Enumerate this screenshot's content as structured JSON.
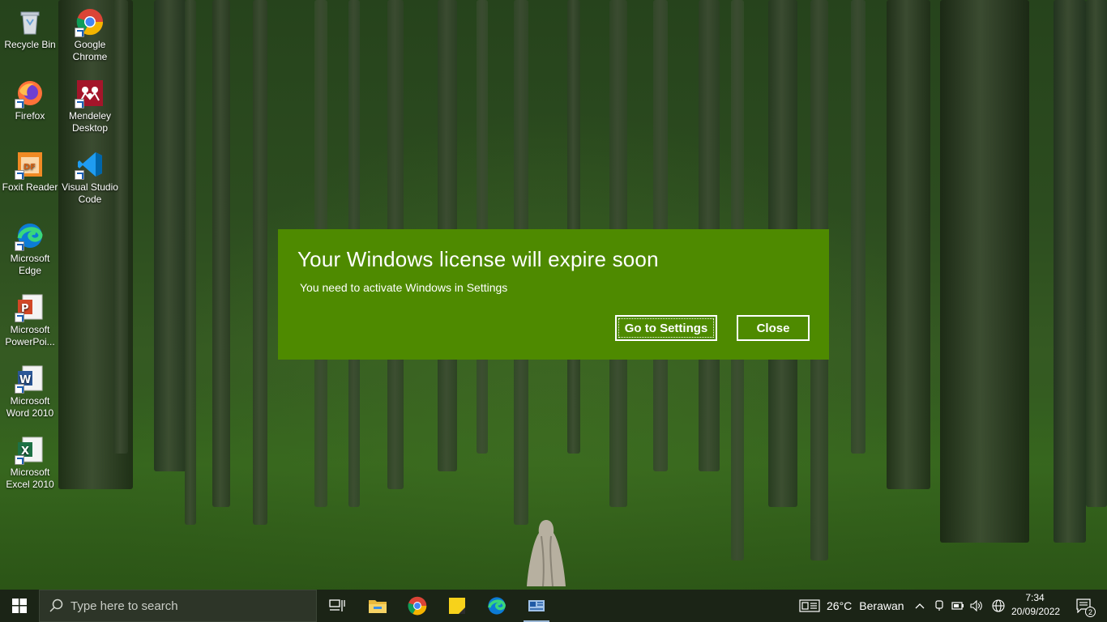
{
  "desktop": {
    "icons": [
      {
        "label": "Recycle Bin",
        "icon": "recycle-bin-icon"
      },
      {
        "label": "Google Chrome",
        "icon": "chrome-icon"
      },
      {
        "label": "Firefox",
        "icon": "firefox-icon"
      },
      {
        "label": "Mendeley Desktop",
        "icon": "mendeley-icon"
      },
      {
        "label": "Foxit Reader",
        "icon": "foxit-reader-icon"
      },
      {
        "label": "Visual Studio Code",
        "icon": "vscode-icon"
      },
      {
        "label": "Microsoft Edge",
        "icon": "edge-icon"
      },
      {
        "label": "Microsoft PowerPoi...",
        "icon": "powerpoint-icon"
      },
      {
        "label": "Microsoft Word 2010",
        "icon": "word-icon"
      },
      {
        "label": "Microsoft Excel 2010",
        "icon": "excel-icon"
      }
    ]
  },
  "dialog": {
    "title": "Your Windows license will expire soon",
    "message": "You need to activate Windows in Settings",
    "settings_button": "Go to Settings",
    "close_button": "Close",
    "background_color": "#4e8a00"
  },
  "taskbar": {
    "search_placeholder": "Type here to search",
    "pinned": [
      "task-view-icon",
      "file-explorer-icon",
      "chrome-icon",
      "sticky-notes-icon",
      "edge-icon",
      "news-app-icon"
    ],
    "weather": {
      "temperature": "26°C",
      "condition": "Berawan"
    },
    "clock": {
      "time": "7:34",
      "date": "20/09/2022"
    },
    "notification_count": "2"
  }
}
